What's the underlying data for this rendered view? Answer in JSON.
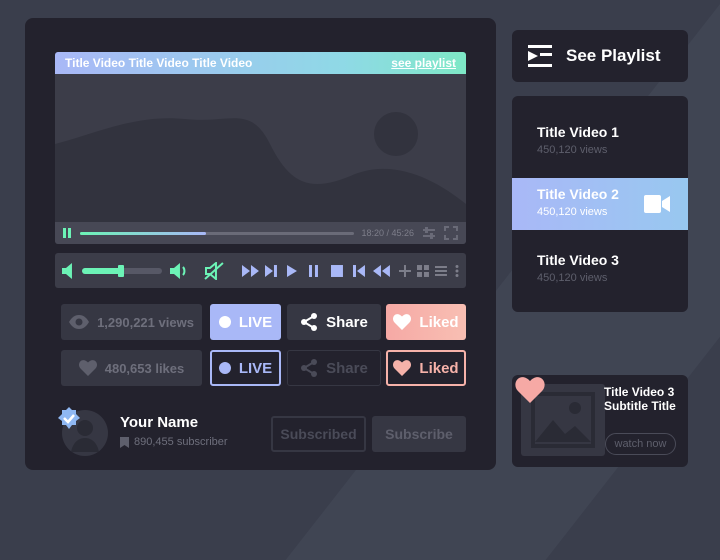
{
  "player": {
    "title": "Title Video Title Video Title Video",
    "playlist_link": "see playlist",
    "time": "18:20 / 45:26",
    "progress": 0.46,
    "volume": 0.5
  },
  "stats": {
    "views": "1,290,221 views",
    "likes": "480,653 likes",
    "live": "LIVE",
    "share": "Share",
    "liked": "Liked"
  },
  "channel": {
    "name": "Your Name",
    "subscribers": "890,455 subscriber",
    "subscribed_label": "Subscribed",
    "subscribe_label": "Subscribe"
  },
  "sidebar": {
    "see_playlist": "See Playlist",
    "items": [
      {
        "title": "Title Video 1",
        "views": "450,120 views"
      },
      {
        "title": "Title Video 2",
        "views": "450,120 views"
      },
      {
        "title": "Title Video 3",
        "views": "450,120 views"
      }
    ]
  },
  "card": {
    "title": "Title Video 3 Subtitle Title",
    "watch_now": "watch now"
  },
  "colors": {
    "accent_blue": "#a9b8f7",
    "accent_green": "#6cf3b6",
    "accent_pink": "#f6a9a5",
    "panel": "#23222d",
    "background": "#3a3e4c"
  }
}
